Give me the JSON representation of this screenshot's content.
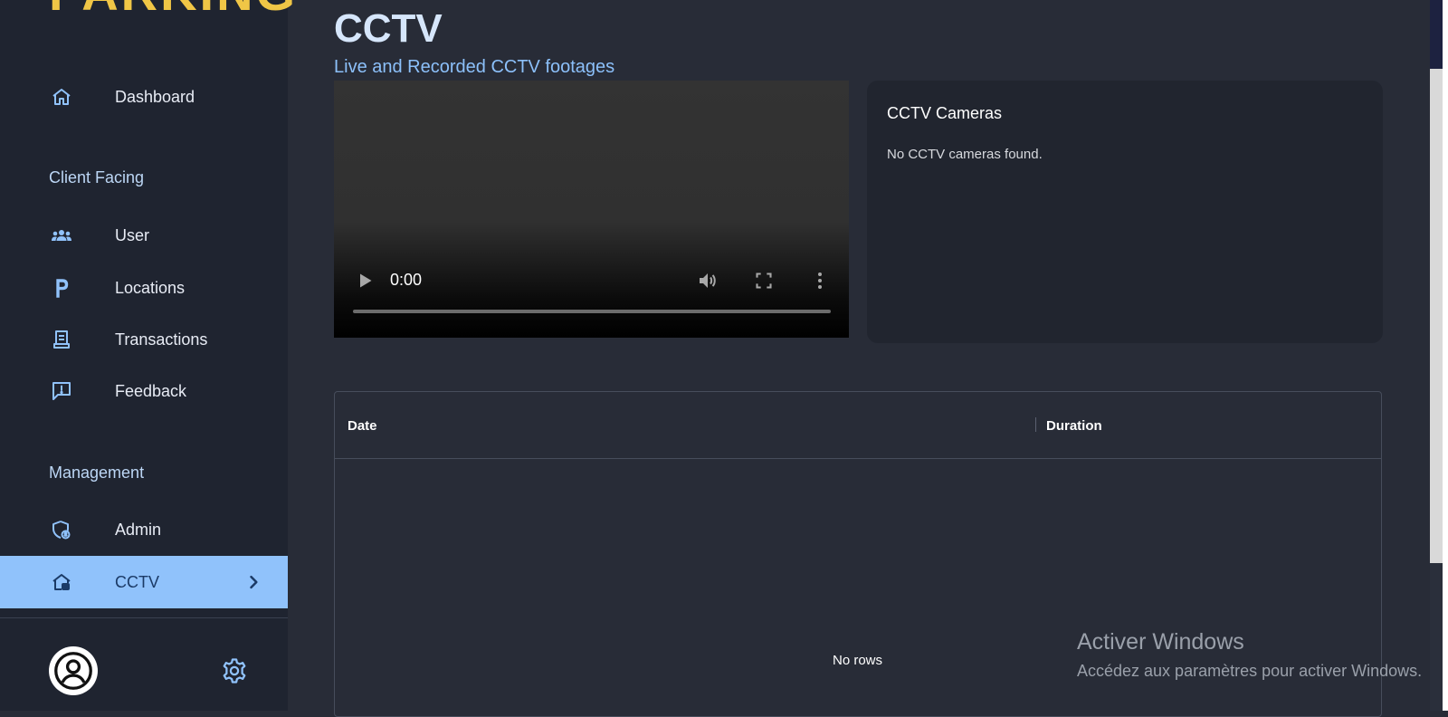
{
  "app": {
    "logo_text": "PARKING"
  },
  "sidebar": {
    "items_top": [
      {
        "label": "Dashboard",
        "icon": "home-icon"
      }
    ],
    "sections": [
      {
        "title": "Client Facing",
        "items": [
          {
            "label": "User",
            "icon": "users-icon"
          },
          {
            "label": "Locations",
            "icon": "parking-icon"
          },
          {
            "label": "Transactions",
            "icon": "receipt-icon"
          },
          {
            "label": "Feedback",
            "icon": "feedback-icon"
          }
        ]
      },
      {
        "title": "Management",
        "items": [
          {
            "label": "Admin",
            "icon": "admin-shield-icon"
          },
          {
            "label": "CCTV",
            "icon": "cctv-icon",
            "active": true
          }
        ]
      }
    ]
  },
  "page": {
    "title": "CCTV",
    "subtitle": "Live and Recorded CCTV footages"
  },
  "video": {
    "time": "0:00"
  },
  "cameras": {
    "title": "CCTV Cameras",
    "empty_text": "No CCTV cameras found."
  },
  "grid": {
    "columns": [
      "Date",
      "Duration"
    ],
    "empty_text": "No rows"
  },
  "watermark": {
    "title": "Activer Windows",
    "subtitle": "Accédez aux paramètres pour activer Windows."
  },
  "colors": {
    "sidebar_bg": "#1f2430",
    "main_bg": "#282c37",
    "accent": "#90c2fb",
    "logo": "#f0c646"
  }
}
